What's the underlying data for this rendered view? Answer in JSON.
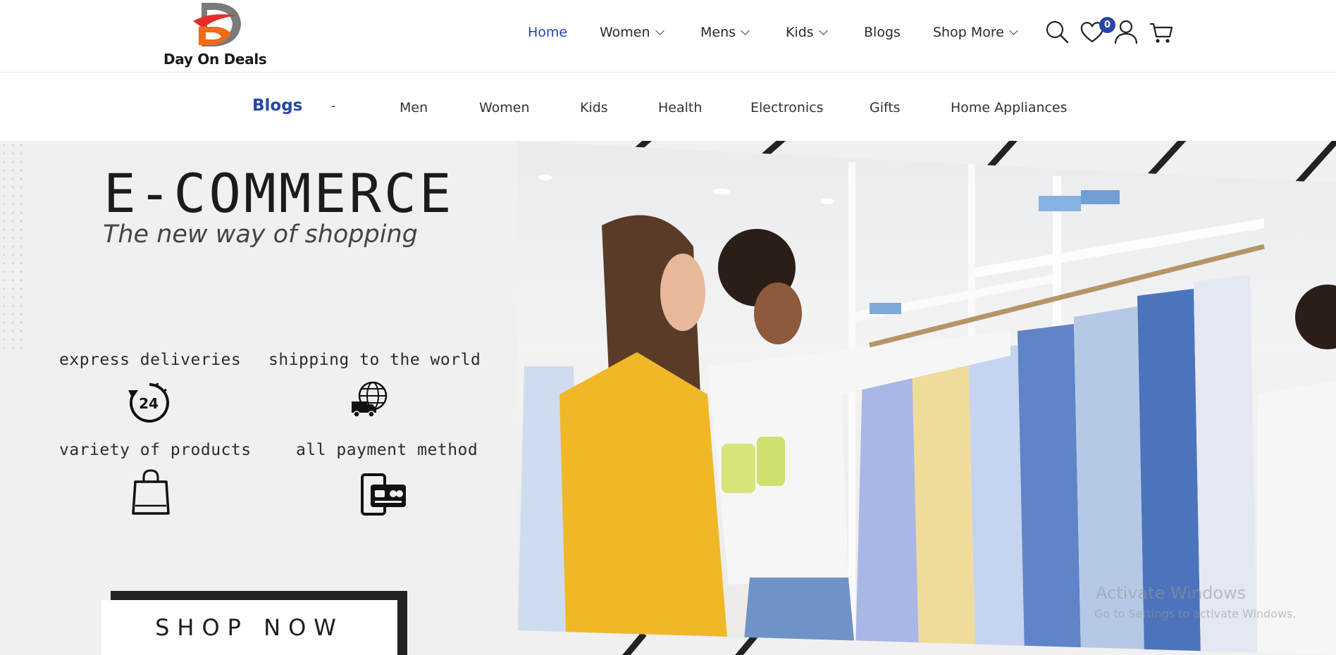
{
  "brand": {
    "name": "Day On Deals"
  },
  "nav": {
    "home": "Home",
    "women": "Women",
    "mens": "Mens",
    "kids": "Kids",
    "blogs": "Blogs",
    "shop_more": "Shop More"
  },
  "wishlist": {
    "count": "0"
  },
  "sub_nav": {
    "title": "Blogs",
    "separator": "-",
    "items": [
      "Men",
      "Women",
      "Kids",
      "Health",
      "Electronics",
      "Gifts",
      "Home Appliances"
    ]
  },
  "hero": {
    "title": "E-COMMERCE",
    "subtitle": "The new way of shopping",
    "features": [
      {
        "label": "express deliveries",
        "icon": "24-hour-clock-icon"
      },
      {
        "label": "shipping to the world",
        "icon": "globe-delivery-truck-icon"
      },
      {
        "label": "variety of products",
        "icon": "shopping-bag-icon"
      },
      {
        "label": "all payment method",
        "icon": "payment-card-icon"
      }
    ],
    "cta": "SHOP NOW"
  },
  "watermark": {
    "line1": "Activate Windows",
    "line2": "Go to Settings to activate Windows."
  },
  "colors": {
    "accent": "#2747a5",
    "logo_orange": "#f06a1a",
    "logo_red": "#e32c2c",
    "hero_bg": "#f0f0f0",
    "jacket": "#f0b727"
  }
}
